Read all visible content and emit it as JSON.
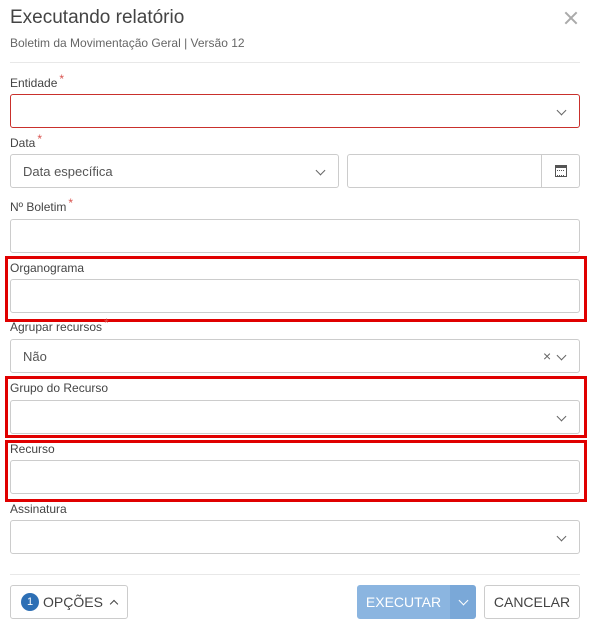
{
  "header": {
    "title": "Executando relatório",
    "subtitle": "Boletim da Movimentação Geral | Versão 12"
  },
  "form": {
    "entidade": {
      "label": "Entidade",
      "required": "*",
      "value": ""
    },
    "data": {
      "label": "Data",
      "required": "*",
      "value": "Data específica",
      "date_value": ""
    },
    "boletim": {
      "label": "Nº Boletim",
      "required": "*",
      "value": ""
    },
    "organograma": {
      "label": "Organograma",
      "value": ""
    },
    "agrupar": {
      "label": "Agrupar recursos",
      "required": "*",
      "value": "Não",
      "clear": "×"
    },
    "grupo": {
      "label": "Grupo do Recurso",
      "value": ""
    },
    "recurso": {
      "label": "Recurso",
      "value": ""
    },
    "assinatura": {
      "label": "Assinatura",
      "value": ""
    }
  },
  "footer": {
    "options_count": "1",
    "options_label": "OPÇÕES",
    "execute_label": "EXECUTAR",
    "cancel_label": "CANCELAR"
  },
  "colors": {
    "highlight": "#e00000",
    "required": "#d9534f",
    "primary": "#8bb5e0",
    "badge": "#2d6fb5"
  }
}
